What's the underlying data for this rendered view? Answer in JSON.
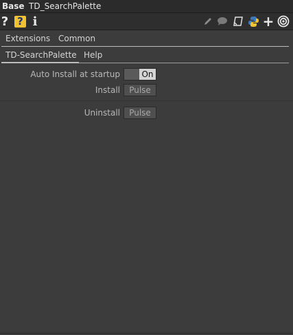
{
  "title": {
    "op_type": "Base",
    "op_name": "TD_SearchPalette"
  },
  "toolbar": {
    "help": "?",
    "opsnippet": "?",
    "info": "i",
    "add": "+"
  },
  "tabs_main": [
    "Extensions",
    "Common"
  ],
  "tabs_page": {
    "active": "TD-SearchPalette",
    "other": "Help"
  },
  "params": {
    "auto_install": {
      "label": "Auto Install at startup",
      "value": "On"
    },
    "install": {
      "label": "Install",
      "button": "Pulse"
    },
    "uninstall": {
      "label": "Uninstall",
      "button": "Pulse"
    }
  },
  "colors": {
    "background": "#3c3c3c",
    "toggle_on": "#d4d4d4",
    "opsnippet_icon": "#f1c232"
  }
}
